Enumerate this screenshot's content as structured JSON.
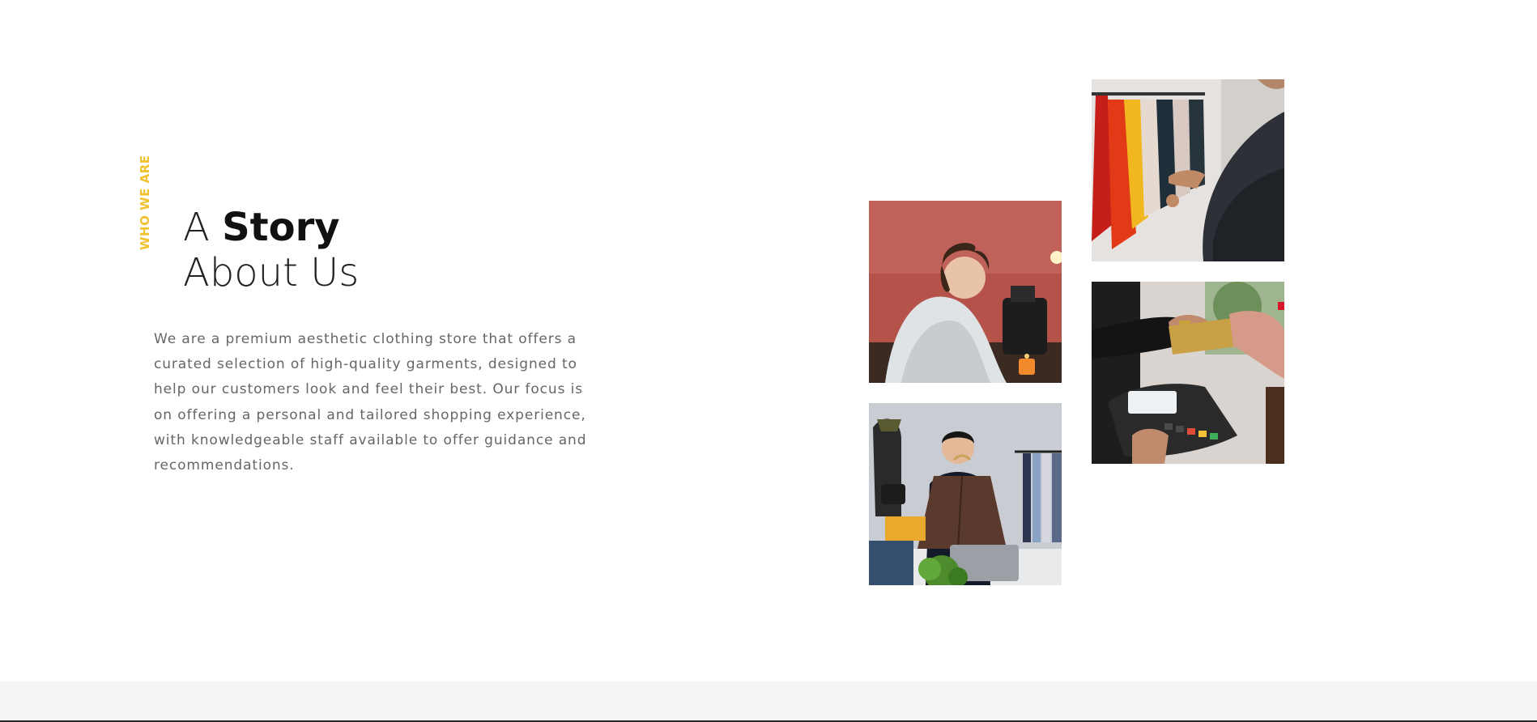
{
  "about": {
    "eyebrow": "WHO WE ARE",
    "headline_prefix": "A ",
    "headline_bold": "Story",
    "headline_line2": "About Us",
    "description": "We are a premium aesthetic clothing store that offers a curated selection of high-quality garments, designed to help our customers look and feel their best. Our focus is on offering a personal and tailored shopping experience, with knowledgeable staff available to offer guidance and recommendations."
  },
  "gallery": {
    "images": [
      {
        "name": "tailor-sewing-photo"
      },
      {
        "name": "clothing-live-stream-photo"
      },
      {
        "name": "clothes-rack-photo"
      },
      {
        "name": "card-payment-photo"
      }
    ]
  },
  "colors": {
    "accent": "#f2c12e",
    "body_text": "#666666",
    "footer_band": "#f4f4f4"
  }
}
